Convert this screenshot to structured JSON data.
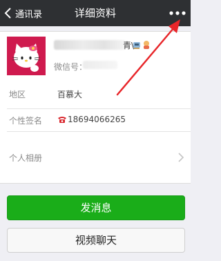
{
  "navbar": {
    "back_label": "通讯录",
    "title": "详细资料"
  },
  "profile": {
    "name_suffix": "青\\",
    "wechat_label": "微信号："
  },
  "info_rows": [
    {
      "label": "地区",
      "value": "百慕大"
    },
    {
      "label": "个性签名",
      "value": "18694066265"
    },
    {
      "label": "个人相册",
      "value": ""
    }
  ],
  "buttons": {
    "send_message": "发消息",
    "video_chat": "视频聊天"
  },
  "colors": {
    "navbar_bg": "#2e3033",
    "primary_button": "#1aad19",
    "avatar_bg": "#cf1a4e",
    "annotation_arrow": "#e8262a"
  },
  "icons": {
    "back": "chevron-left-icon",
    "more": "more-icon",
    "signature_prefix": "telephone-icon",
    "album_chevron": "chevron-right-icon"
  }
}
